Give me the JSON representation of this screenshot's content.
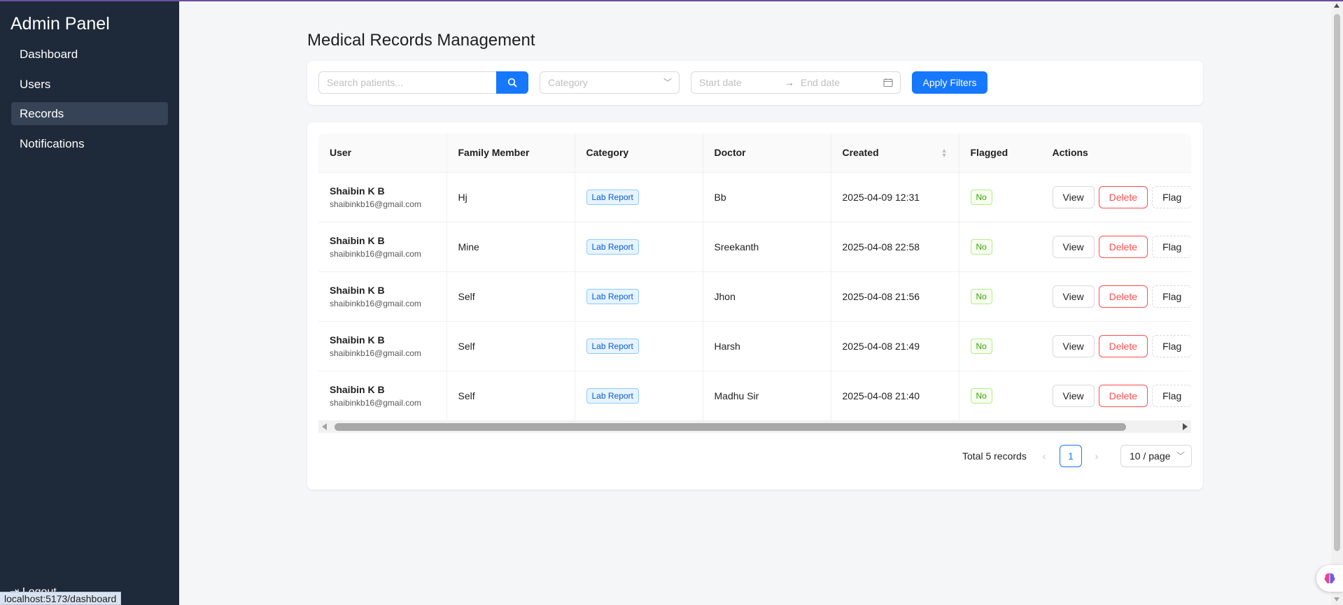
{
  "app": {
    "title": "Admin Panel"
  },
  "sidebar": {
    "items": [
      {
        "label": "Dashboard"
      },
      {
        "label": "Users"
      },
      {
        "label": "Records",
        "active": true
      },
      {
        "label": "Notifications"
      }
    ],
    "logout_label": "Logout",
    "logout_icon": "logout-icon"
  },
  "status_url": "localhost:5173/dashboard",
  "main": {
    "title": "Medical Records Management"
  },
  "filters": {
    "search_placeholder": "Search patients...",
    "search_icon": "search-icon",
    "category_placeholder": "Category",
    "start_date_placeholder": "Start date",
    "end_date_placeholder": "End date",
    "range_arrow": "→",
    "apply_label": "Apply Filters"
  },
  "table": {
    "columns": [
      "User",
      "Family Member",
      "Category",
      "Doctor",
      "Created",
      "Flagged",
      "Actions"
    ],
    "rows": [
      {
        "user_name": "Shaibin K B",
        "user_email": "shaibinkb16@gmail.com",
        "family_member": "Hj",
        "category": "Lab Report",
        "doctor": "Bb",
        "created": "2025-04-09 12:31",
        "flagged": "No"
      },
      {
        "user_name": "Shaibin K B",
        "user_email": "shaibinkb16@gmail.com",
        "family_member": "Mine",
        "category": "Lab Report",
        "doctor": "Sreekanth",
        "created": "2025-04-08 22:58",
        "flagged": "No"
      },
      {
        "user_name": "Shaibin K B",
        "user_email": "shaibinkb16@gmail.com",
        "family_member": "Self",
        "category": "Lab Report",
        "doctor": "Jhon",
        "created": "2025-04-08 21:56",
        "flagged": "No"
      },
      {
        "user_name": "Shaibin K B",
        "user_email": "shaibinkb16@gmail.com",
        "family_member": "Self",
        "category": "Lab Report",
        "doctor": "Harsh",
        "created": "2025-04-08 21:49",
        "flagged": "No"
      },
      {
        "user_name": "Shaibin K B",
        "user_email": "shaibinkb16@gmail.com",
        "family_member": "Self",
        "category": "Lab Report",
        "doctor": "Madhu Sir",
        "created": "2025-04-08 21:40",
        "flagged": "No"
      }
    ],
    "actions": {
      "view": "View",
      "delete": "Delete",
      "flag": "Flag"
    }
  },
  "pagination": {
    "total_text": "Total 5 records",
    "current_page": "1",
    "page_size": "10 / page",
    "prev": "‹",
    "next": "›"
  },
  "colors": {
    "sidebar_bg": "#1e2939",
    "primary": "#1677ff",
    "danger": "#ff4d4f",
    "success": "#389e0d"
  }
}
